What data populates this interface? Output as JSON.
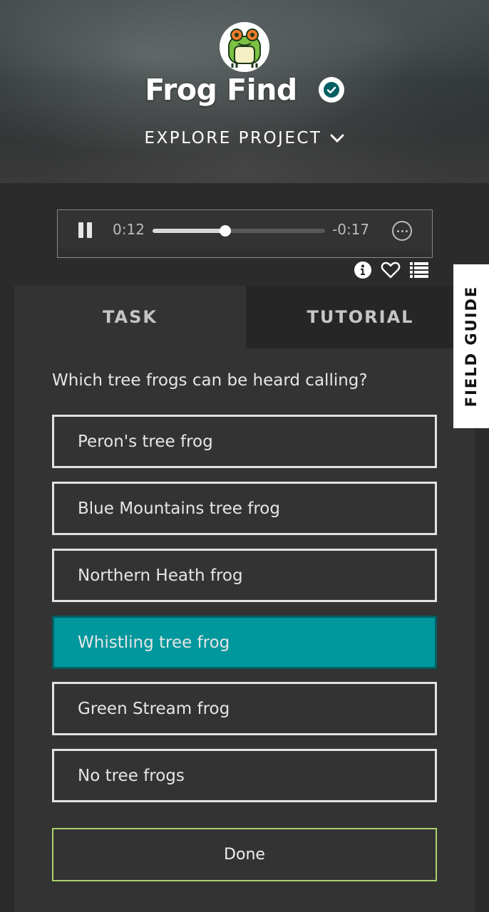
{
  "project": {
    "title": "Frog Find",
    "explore_label": "EXPLORE PROJECT",
    "avatar_icon": "frog-avatar-icon",
    "verified_icon": "verified-check-icon"
  },
  "player": {
    "current_time": "0:12",
    "remaining_time": "-0:17",
    "progress": 0.42,
    "pause_icon": "pause-icon",
    "more_icon": "more-options-icon"
  },
  "meta_icons": [
    "info-icon",
    "heart-icon",
    "list-icon"
  ],
  "tabs": [
    {
      "label": "TASK",
      "active": true
    },
    {
      "label": "TUTORIAL",
      "active": false
    }
  ],
  "task": {
    "question": "Which tree frogs can be heard calling?",
    "answers": [
      {
        "label": "Peron's tree frog",
        "selected": false
      },
      {
        "label": "Blue Mountains tree frog",
        "selected": false
      },
      {
        "label": "Northern Heath frog",
        "selected": false
      },
      {
        "label": "Whistling tree frog",
        "selected": true
      },
      {
        "label": "Green Stream frog",
        "selected": false
      },
      {
        "label": "No tree frogs",
        "selected": false
      }
    ],
    "done_label": "Done"
  },
  "field_guide_label": "FIELD GUIDE",
  "colors": {
    "selected": "#00979d",
    "done_border": "#a9d36c",
    "verified": "#005f63"
  }
}
